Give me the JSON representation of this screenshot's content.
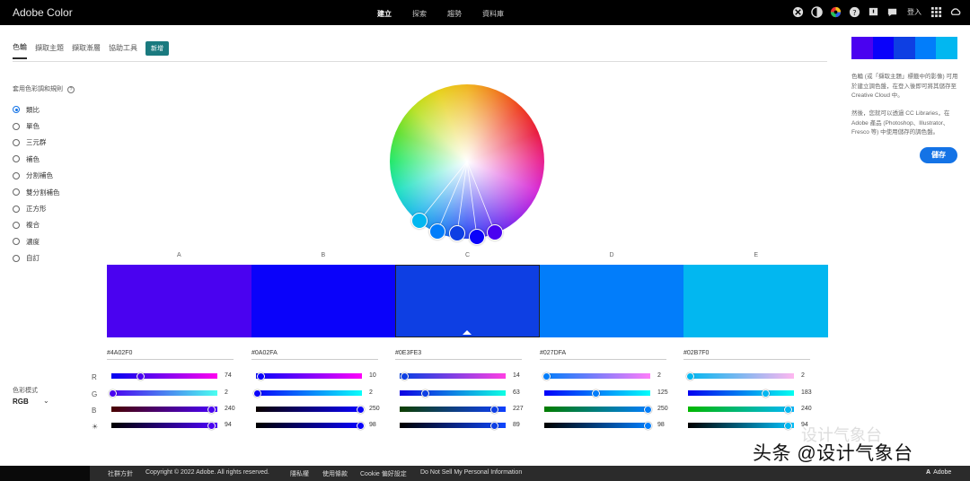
{
  "app": {
    "title": "Adobe Color"
  },
  "topnav": {
    "items": [
      "建立",
      "探索",
      "趨勢",
      "資料庫"
    ],
    "active": 0,
    "login": "登入"
  },
  "tabs": {
    "items": [
      "色輪",
      "擷取主題",
      "擷取漸層",
      "協助工具"
    ],
    "active": 0,
    "badge": "新增"
  },
  "harmony": {
    "label": "套用色彩調和規則",
    "rules": [
      "類比",
      "單色",
      "三元群",
      "補色",
      "分割補色",
      "雙分割補色",
      "正方形",
      "複合",
      "濃度",
      "自訂"
    ],
    "selected": 0
  },
  "color_mode": {
    "label": "色彩模式",
    "value": "RGB"
  },
  "wheel": {
    "handles": [
      {
        "color": "#02B7F0",
        "label": "E"
      },
      {
        "color": "#027DFA",
        "label": "D"
      },
      {
        "color": "#0E3FE3",
        "label": "C"
      },
      {
        "color": "#0A02FA",
        "label": "B"
      },
      {
        "color": "#4A02F0",
        "label": "A"
      }
    ]
  },
  "swatches": [
    {
      "label": "A",
      "hex": "#4A02F0",
      "r": 74,
      "g": 2,
      "b": 240,
      "bright": 94
    },
    {
      "label": "B",
      "hex": "#0A02FA",
      "r": 10,
      "g": 2,
      "b": 250,
      "bright": 98
    },
    {
      "label": "C",
      "hex": "#0E3FE3",
      "r": 14,
      "g": 63,
      "b": 227,
      "bright": 89
    },
    {
      "label": "D",
      "hex": "#027DFA",
      "r": 2,
      "g": 125,
      "b": 250,
      "bright": 98
    },
    {
      "label": "E",
      "hex": "#02B7F0",
      "r": 2,
      "g": 183,
      "b": 240,
      "bright": 94
    }
  ],
  "selected_swatch": 2,
  "channels": [
    "R",
    "G",
    "B",
    "☀"
  ],
  "right_panel": {
    "text1": "色輪 (或「擷取主題」標籤中的影像) 可用於建立調色盤，在登入後即可將其儲存至 Creative Cloud 中。",
    "text2": "然後，您就可以透過 CC Libraries，在 Adobe 產品 (Photoshop、Illustrator、Fresco 等) 中使用儲存的調色盤。",
    "save": "儲存"
  },
  "footer": {
    "links": [
      "社群方針",
      "Copyright © 2022 Adobe. All rights reserved.",
      "隱私權",
      "使用條款",
      "Cookie 偏好設定",
      "Do Not Sell My Personal Information"
    ],
    "brand": "Adobe"
  },
  "watermark": {
    "text": "头条 @设计气象台",
    "ghost": "设计气象台"
  }
}
